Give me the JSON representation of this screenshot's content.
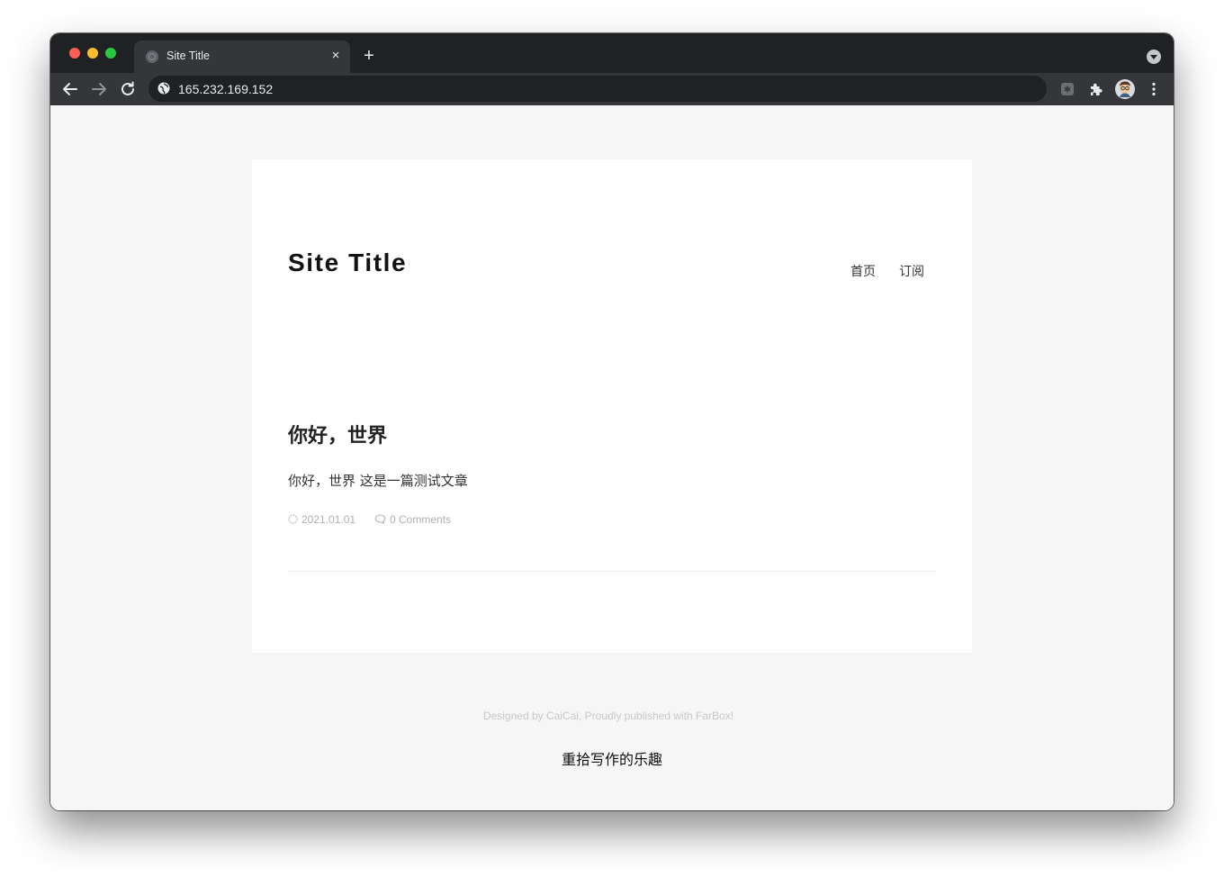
{
  "browser": {
    "tab_title": "Site Title",
    "new_tab_symbol": "+",
    "close_symbol": "×",
    "url": "165.232.169.152",
    "traffic_colors": [
      "#ff5f57",
      "#febc2e",
      "#28c840"
    ]
  },
  "page": {
    "site_title": "Site Title",
    "nav": [
      {
        "label": "首页"
      },
      {
        "label": "订阅"
      }
    ],
    "posts": [
      {
        "title": "你好，世界",
        "excerpt": "你好，世界 这是一篇测试文章",
        "date": "2021.01.01",
        "comments": "0 Comments"
      }
    ]
  },
  "footer": {
    "credit": "Designed by CaiCai,  Proudly published with FarBox!",
    "slogan": "重拾写作的乐趣"
  }
}
